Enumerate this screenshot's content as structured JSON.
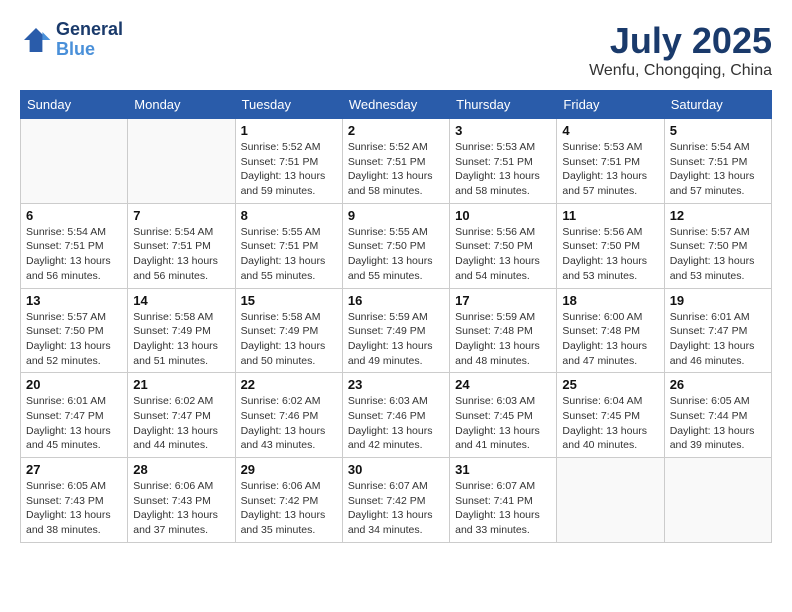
{
  "header": {
    "logo_line1": "General",
    "logo_line2": "Blue",
    "month_title": "July 2025",
    "location": "Wenfu, Chongqing, China"
  },
  "weekdays": [
    "Sunday",
    "Monday",
    "Tuesday",
    "Wednesday",
    "Thursday",
    "Friday",
    "Saturday"
  ],
  "weeks": [
    [
      {
        "day": "",
        "info": ""
      },
      {
        "day": "",
        "info": ""
      },
      {
        "day": "1",
        "info": "Sunrise: 5:52 AM\nSunset: 7:51 PM\nDaylight: 13 hours\nand 59 minutes."
      },
      {
        "day": "2",
        "info": "Sunrise: 5:52 AM\nSunset: 7:51 PM\nDaylight: 13 hours\nand 58 minutes."
      },
      {
        "day": "3",
        "info": "Sunrise: 5:53 AM\nSunset: 7:51 PM\nDaylight: 13 hours\nand 58 minutes."
      },
      {
        "day": "4",
        "info": "Sunrise: 5:53 AM\nSunset: 7:51 PM\nDaylight: 13 hours\nand 57 minutes."
      },
      {
        "day": "5",
        "info": "Sunrise: 5:54 AM\nSunset: 7:51 PM\nDaylight: 13 hours\nand 57 minutes."
      }
    ],
    [
      {
        "day": "6",
        "info": "Sunrise: 5:54 AM\nSunset: 7:51 PM\nDaylight: 13 hours\nand 56 minutes."
      },
      {
        "day": "7",
        "info": "Sunrise: 5:54 AM\nSunset: 7:51 PM\nDaylight: 13 hours\nand 56 minutes."
      },
      {
        "day": "8",
        "info": "Sunrise: 5:55 AM\nSunset: 7:51 PM\nDaylight: 13 hours\nand 55 minutes."
      },
      {
        "day": "9",
        "info": "Sunrise: 5:55 AM\nSunset: 7:50 PM\nDaylight: 13 hours\nand 55 minutes."
      },
      {
        "day": "10",
        "info": "Sunrise: 5:56 AM\nSunset: 7:50 PM\nDaylight: 13 hours\nand 54 minutes."
      },
      {
        "day": "11",
        "info": "Sunrise: 5:56 AM\nSunset: 7:50 PM\nDaylight: 13 hours\nand 53 minutes."
      },
      {
        "day": "12",
        "info": "Sunrise: 5:57 AM\nSunset: 7:50 PM\nDaylight: 13 hours\nand 53 minutes."
      }
    ],
    [
      {
        "day": "13",
        "info": "Sunrise: 5:57 AM\nSunset: 7:50 PM\nDaylight: 13 hours\nand 52 minutes."
      },
      {
        "day": "14",
        "info": "Sunrise: 5:58 AM\nSunset: 7:49 PM\nDaylight: 13 hours\nand 51 minutes."
      },
      {
        "day": "15",
        "info": "Sunrise: 5:58 AM\nSunset: 7:49 PM\nDaylight: 13 hours\nand 50 minutes."
      },
      {
        "day": "16",
        "info": "Sunrise: 5:59 AM\nSunset: 7:49 PM\nDaylight: 13 hours\nand 49 minutes."
      },
      {
        "day": "17",
        "info": "Sunrise: 5:59 AM\nSunset: 7:48 PM\nDaylight: 13 hours\nand 48 minutes."
      },
      {
        "day": "18",
        "info": "Sunrise: 6:00 AM\nSunset: 7:48 PM\nDaylight: 13 hours\nand 47 minutes."
      },
      {
        "day": "19",
        "info": "Sunrise: 6:01 AM\nSunset: 7:47 PM\nDaylight: 13 hours\nand 46 minutes."
      }
    ],
    [
      {
        "day": "20",
        "info": "Sunrise: 6:01 AM\nSunset: 7:47 PM\nDaylight: 13 hours\nand 45 minutes."
      },
      {
        "day": "21",
        "info": "Sunrise: 6:02 AM\nSunset: 7:47 PM\nDaylight: 13 hours\nand 44 minutes."
      },
      {
        "day": "22",
        "info": "Sunrise: 6:02 AM\nSunset: 7:46 PM\nDaylight: 13 hours\nand 43 minutes."
      },
      {
        "day": "23",
        "info": "Sunrise: 6:03 AM\nSunset: 7:46 PM\nDaylight: 13 hours\nand 42 minutes."
      },
      {
        "day": "24",
        "info": "Sunrise: 6:03 AM\nSunset: 7:45 PM\nDaylight: 13 hours\nand 41 minutes."
      },
      {
        "day": "25",
        "info": "Sunrise: 6:04 AM\nSunset: 7:45 PM\nDaylight: 13 hours\nand 40 minutes."
      },
      {
        "day": "26",
        "info": "Sunrise: 6:05 AM\nSunset: 7:44 PM\nDaylight: 13 hours\nand 39 minutes."
      }
    ],
    [
      {
        "day": "27",
        "info": "Sunrise: 6:05 AM\nSunset: 7:43 PM\nDaylight: 13 hours\nand 38 minutes."
      },
      {
        "day": "28",
        "info": "Sunrise: 6:06 AM\nSunset: 7:43 PM\nDaylight: 13 hours\nand 37 minutes."
      },
      {
        "day": "29",
        "info": "Sunrise: 6:06 AM\nSunset: 7:42 PM\nDaylight: 13 hours\nand 35 minutes."
      },
      {
        "day": "30",
        "info": "Sunrise: 6:07 AM\nSunset: 7:42 PM\nDaylight: 13 hours\nand 34 minutes."
      },
      {
        "day": "31",
        "info": "Sunrise: 6:07 AM\nSunset: 7:41 PM\nDaylight: 13 hours\nand 33 minutes."
      },
      {
        "day": "",
        "info": ""
      },
      {
        "day": "",
        "info": ""
      }
    ]
  ]
}
